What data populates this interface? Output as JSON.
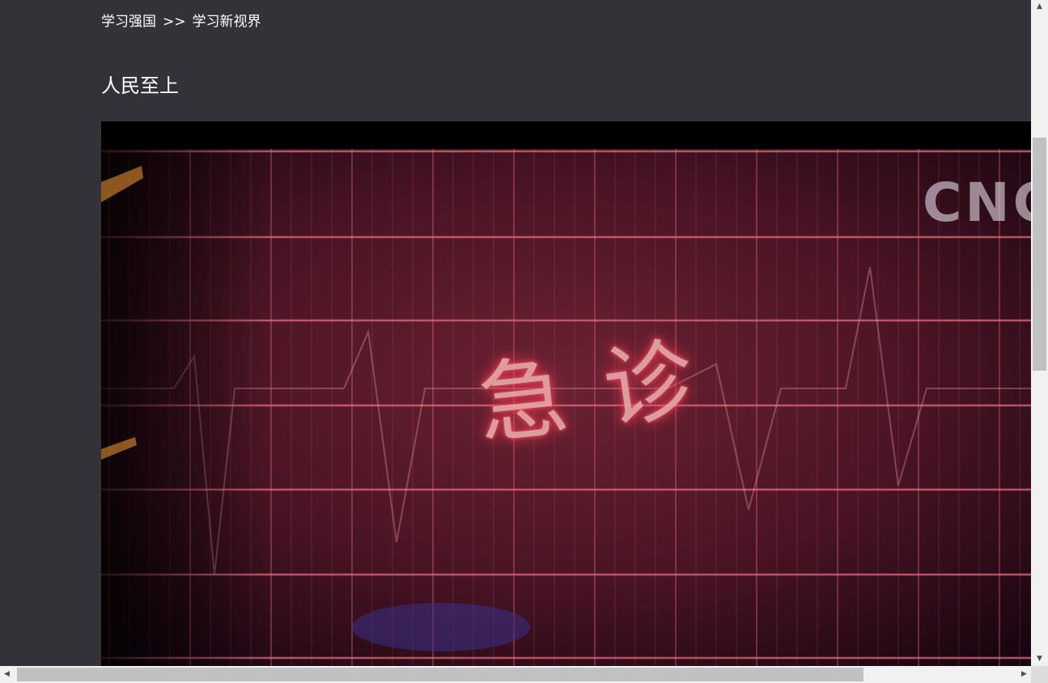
{
  "breadcrumb": {
    "home": "学习强国",
    "separator": ">>",
    "section": "学习新视界"
  },
  "page_title": "人民至上",
  "video": {
    "watermark": "CNC",
    "title_char_1": "急",
    "title_char_2": "诊"
  },
  "scrollbars": {
    "vertical": {
      "up_icon": "triangle-up-icon",
      "down_icon": "triangle-down-icon"
    },
    "horizontal": {
      "left_icon": "triangle-left-icon",
      "right_icon": "triangle-right-icon"
    }
  },
  "colors": {
    "background": "#323238",
    "text": "#ffffff",
    "video_grid": "#e36a7e"
  }
}
